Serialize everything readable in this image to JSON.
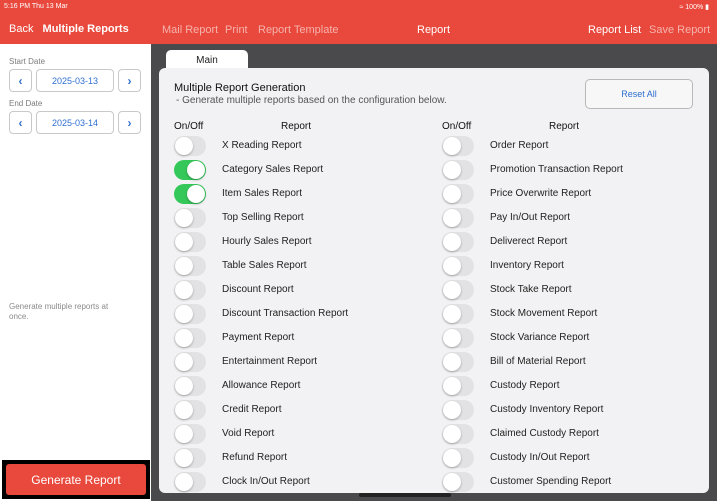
{
  "status_bar": {
    "time": "5:16 PM  Thu 13 Mar",
    "battery": "100%"
  },
  "left_panel": {
    "back_label": "Back",
    "title": "Multiple Reports",
    "start_date_label": "Start Date",
    "start_date": "2025-03-13",
    "end_date_label": "End Date",
    "end_date": "2025-03-14",
    "hint": "Generate multiple reports at once.",
    "generate_label": "Generate Report"
  },
  "topbar": {
    "mail_label": "Mail Report",
    "print_label": "Print",
    "template_label": "Report Template",
    "title": "Report",
    "list_label": "Report List",
    "save_label": "Save Report"
  },
  "tab": {
    "label": "Main"
  },
  "panel": {
    "title": "Multiple Report Generation",
    "subtitle": "- Generate multiple reports based on the configuration below.",
    "reset_label": "Reset All",
    "col_onoff": "On/Off",
    "col_report": "Report"
  },
  "left_reports": [
    {
      "name": "X Reading Report",
      "on": false
    },
    {
      "name": "Category Sales Report",
      "on": true
    },
    {
      "name": "Item Sales Report",
      "on": true
    },
    {
      "name": "Top Selling Report",
      "on": false
    },
    {
      "name": "Hourly Sales Report",
      "on": false
    },
    {
      "name": "Table Sales Report",
      "on": false
    },
    {
      "name": "Discount Report",
      "on": false
    },
    {
      "name": "Discount Transaction Report",
      "on": false
    },
    {
      "name": "Payment Report",
      "on": false
    },
    {
      "name": "Entertainment Report",
      "on": false
    },
    {
      "name": "Allowance Report",
      "on": false
    },
    {
      "name": "Credit Report",
      "on": false
    },
    {
      "name": "Void Report",
      "on": false
    },
    {
      "name": "Refund Report",
      "on": false
    },
    {
      "name": "Clock In/Out Report",
      "on": false
    }
  ],
  "right_reports": [
    {
      "name": "Order Report",
      "on": false
    },
    {
      "name": "Promotion Transaction Report",
      "on": false
    },
    {
      "name": "Price Overwrite Report",
      "on": false
    },
    {
      "name": "Pay In/Out Report",
      "on": false
    },
    {
      "name": "Deliverect Report",
      "on": false
    },
    {
      "name": "Inventory Report",
      "on": false
    },
    {
      "name": "Stock Take Report",
      "on": false
    },
    {
      "name": "Stock Movement Report",
      "on": false
    },
    {
      "name": "Stock Variance Report",
      "on": false
    },
    {
      "name": "Bill of Material Report",
      "on": false
    },
    {
      "name": "Custody Report",
      "on": false
    },
    {
      "name": "Custody Inventory Report",
      "on": false
    },
    {
      "name": "Claimed Custody Report",
      "on": false
    },
    {
      "name": "Custody In/Out Report",
      "on": false
    },
    {
      "name": "Customer Spending Report",
      "on": false
    }
  ],
  "colors": {
    "accent": "#e9483c",
    "toggle_on": "#34c759",
    "link": "#2f6fd1"
  }
}
